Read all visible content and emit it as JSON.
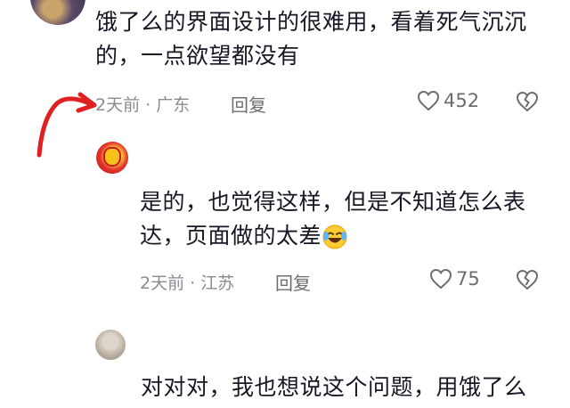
{
  "comments": [
    {
      "text": "饿了么的界面设计的很难用，看着死气沉沉的，一点欲望都没有",
      "time_location": "2天前 · 广东",
      "reply_label": "回复",
      "likes": "452"
    },
    {
      "text": "是的，也觉得这样，但是不知道怎么表达，页面做的太差",
      "emoji": "rolling-on-floor-laughing",
      "time_location": "2天前 · 江苏",
      "reply_label": "回复",
      "likes": "75"
    },
    {
      "text": "对对对，我也想说这个问题，用饿了么"
    }
  ],
  "colors": {
    "annotation_arrow": "#e02020",
    "meta_text": "#8a8b91"
  },
  "icons": [
    "heart-outline-icon",
    "broken-heart-icon"
  ]
}
